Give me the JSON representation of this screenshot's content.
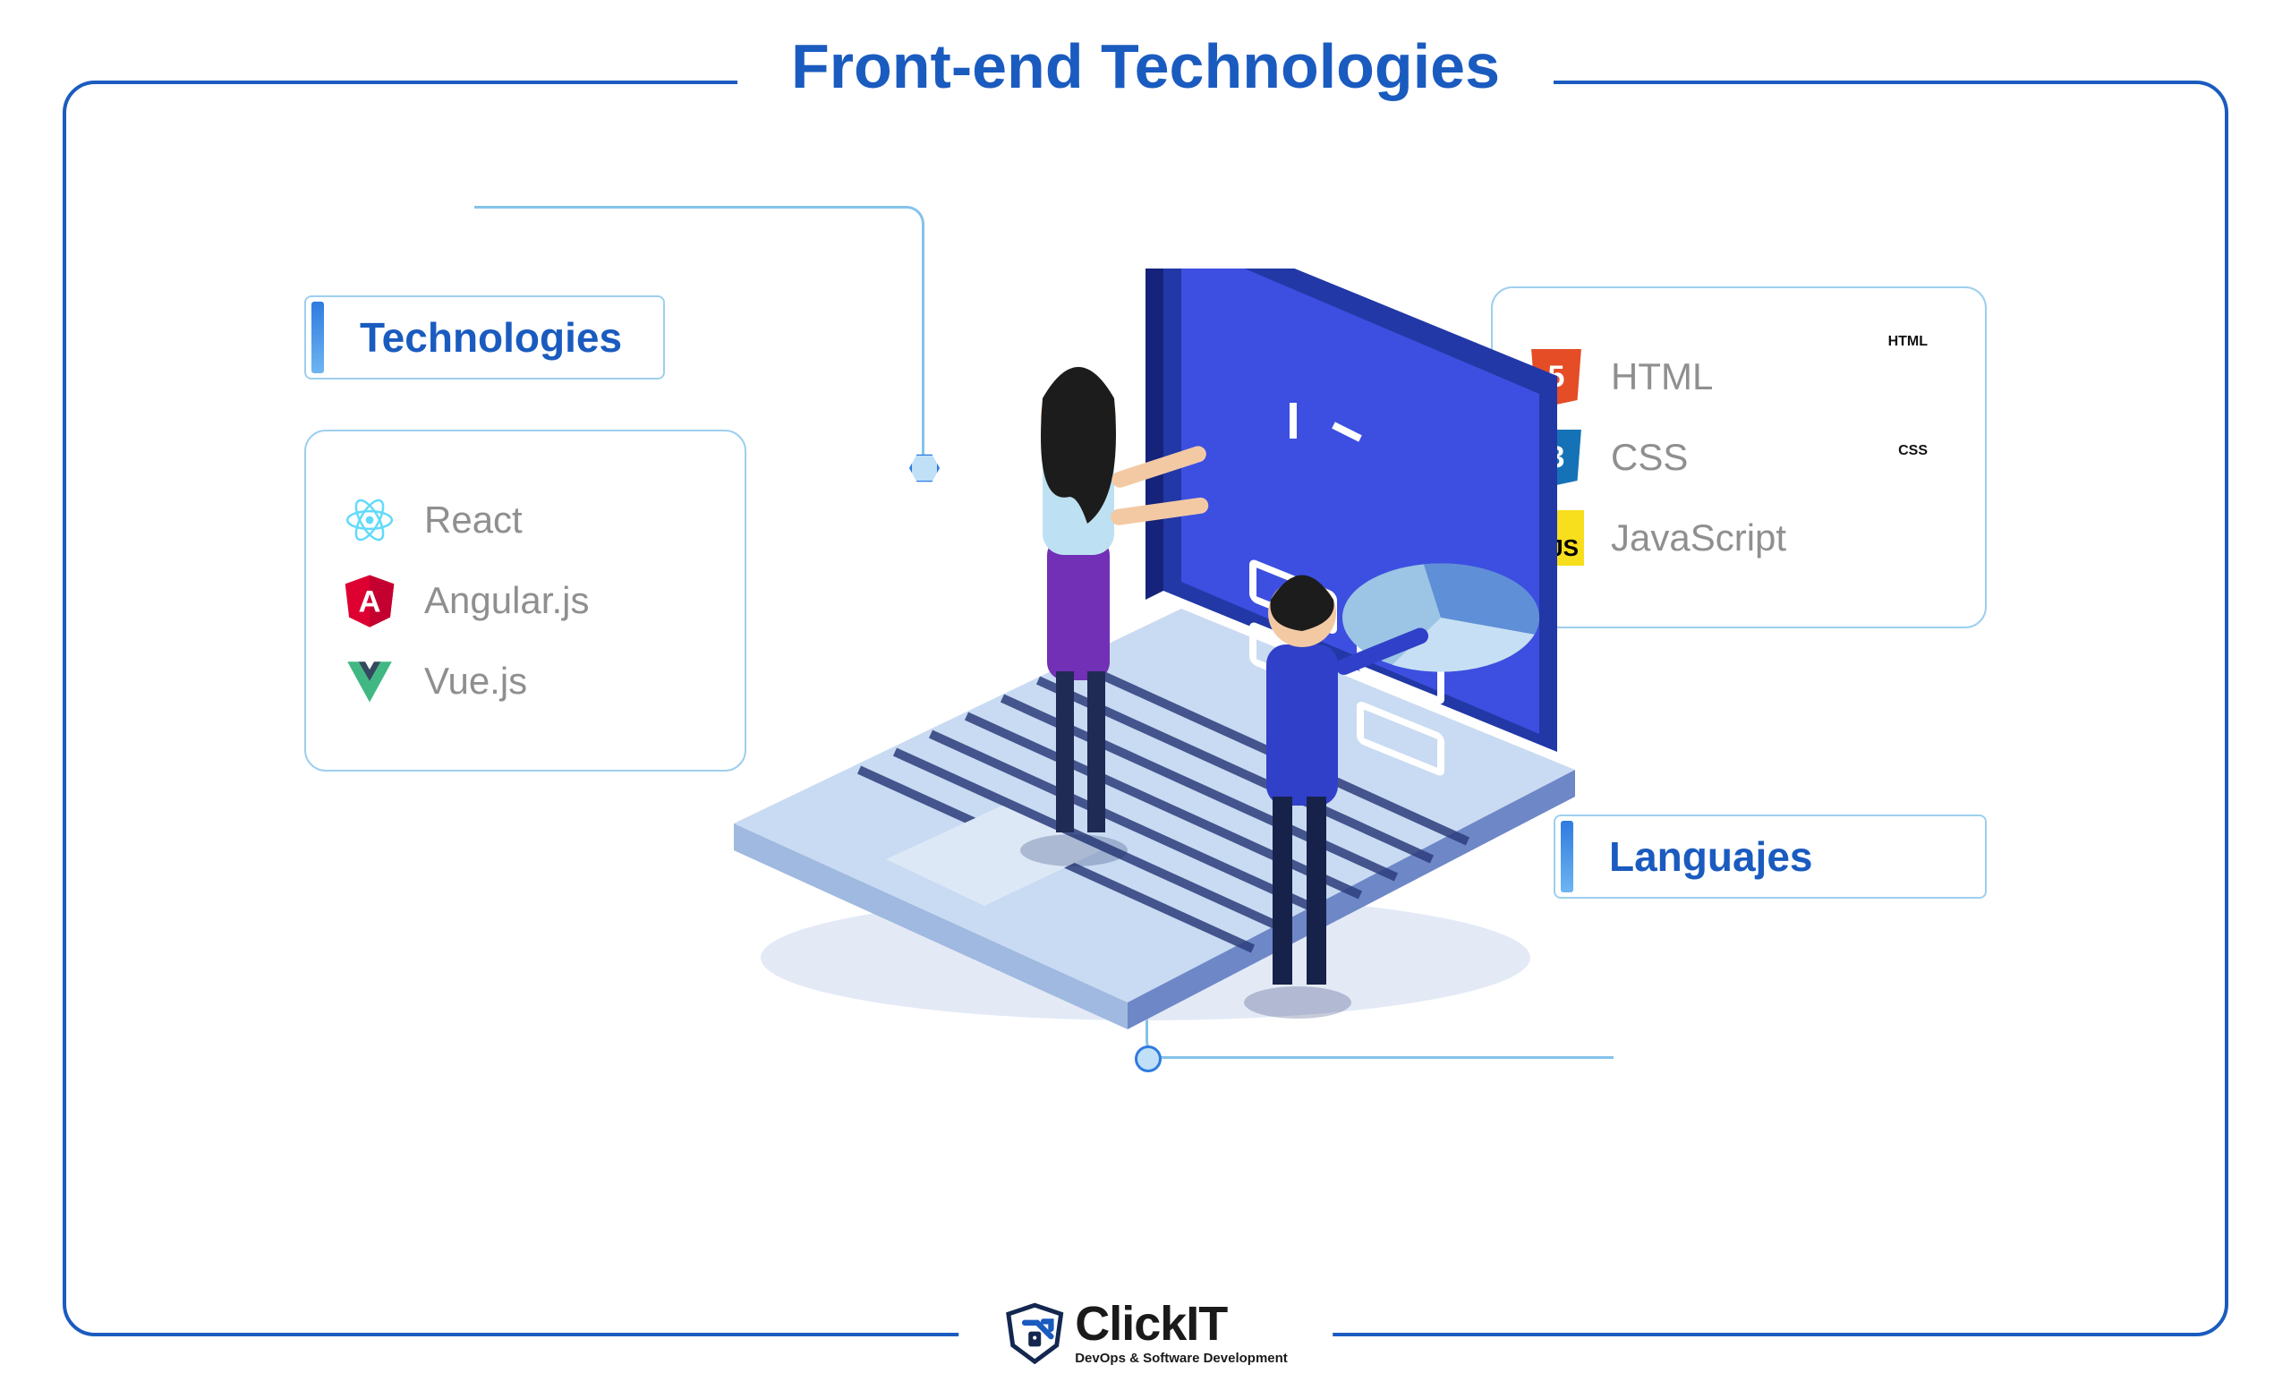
{
  "title": "Front-end Technologies",
  "sections": {
    "technologies": {
      "label": "Technologies",
      "items": [
        {
          "name": "React",
          "icon": "react-icon"
        },
        {
          "name": "Angular.js",
          "icon": "angular-icon"
        },
        {
          "name": "Vue.js",
          "icon": "vue-icon"
        }
      ]
    },
    "languages": {
      "label": "Languajes",
      "items": [
        {
          "name": "HTML",
          "icon": "html5-icon",
          "badge": "HTML"
        },
        {
          "name": "CSS",
          "icon": "css3-icon",
          "badge": "CSS"
        },
        {
          "name": "JavaScript",
          "icon": "js-icon"
        }
      ]
    }
  },
  "brand": {
    "name": "ClickIT",
    "tagline": "DevOps & Software Development"
  },
  "colors": {
    "primary": "#1A5BBF",
    "connector": "#84C3EB",
    "card_border": "#9ECFEE",
    "text_muted": "#8f8f8f"
  }
}
